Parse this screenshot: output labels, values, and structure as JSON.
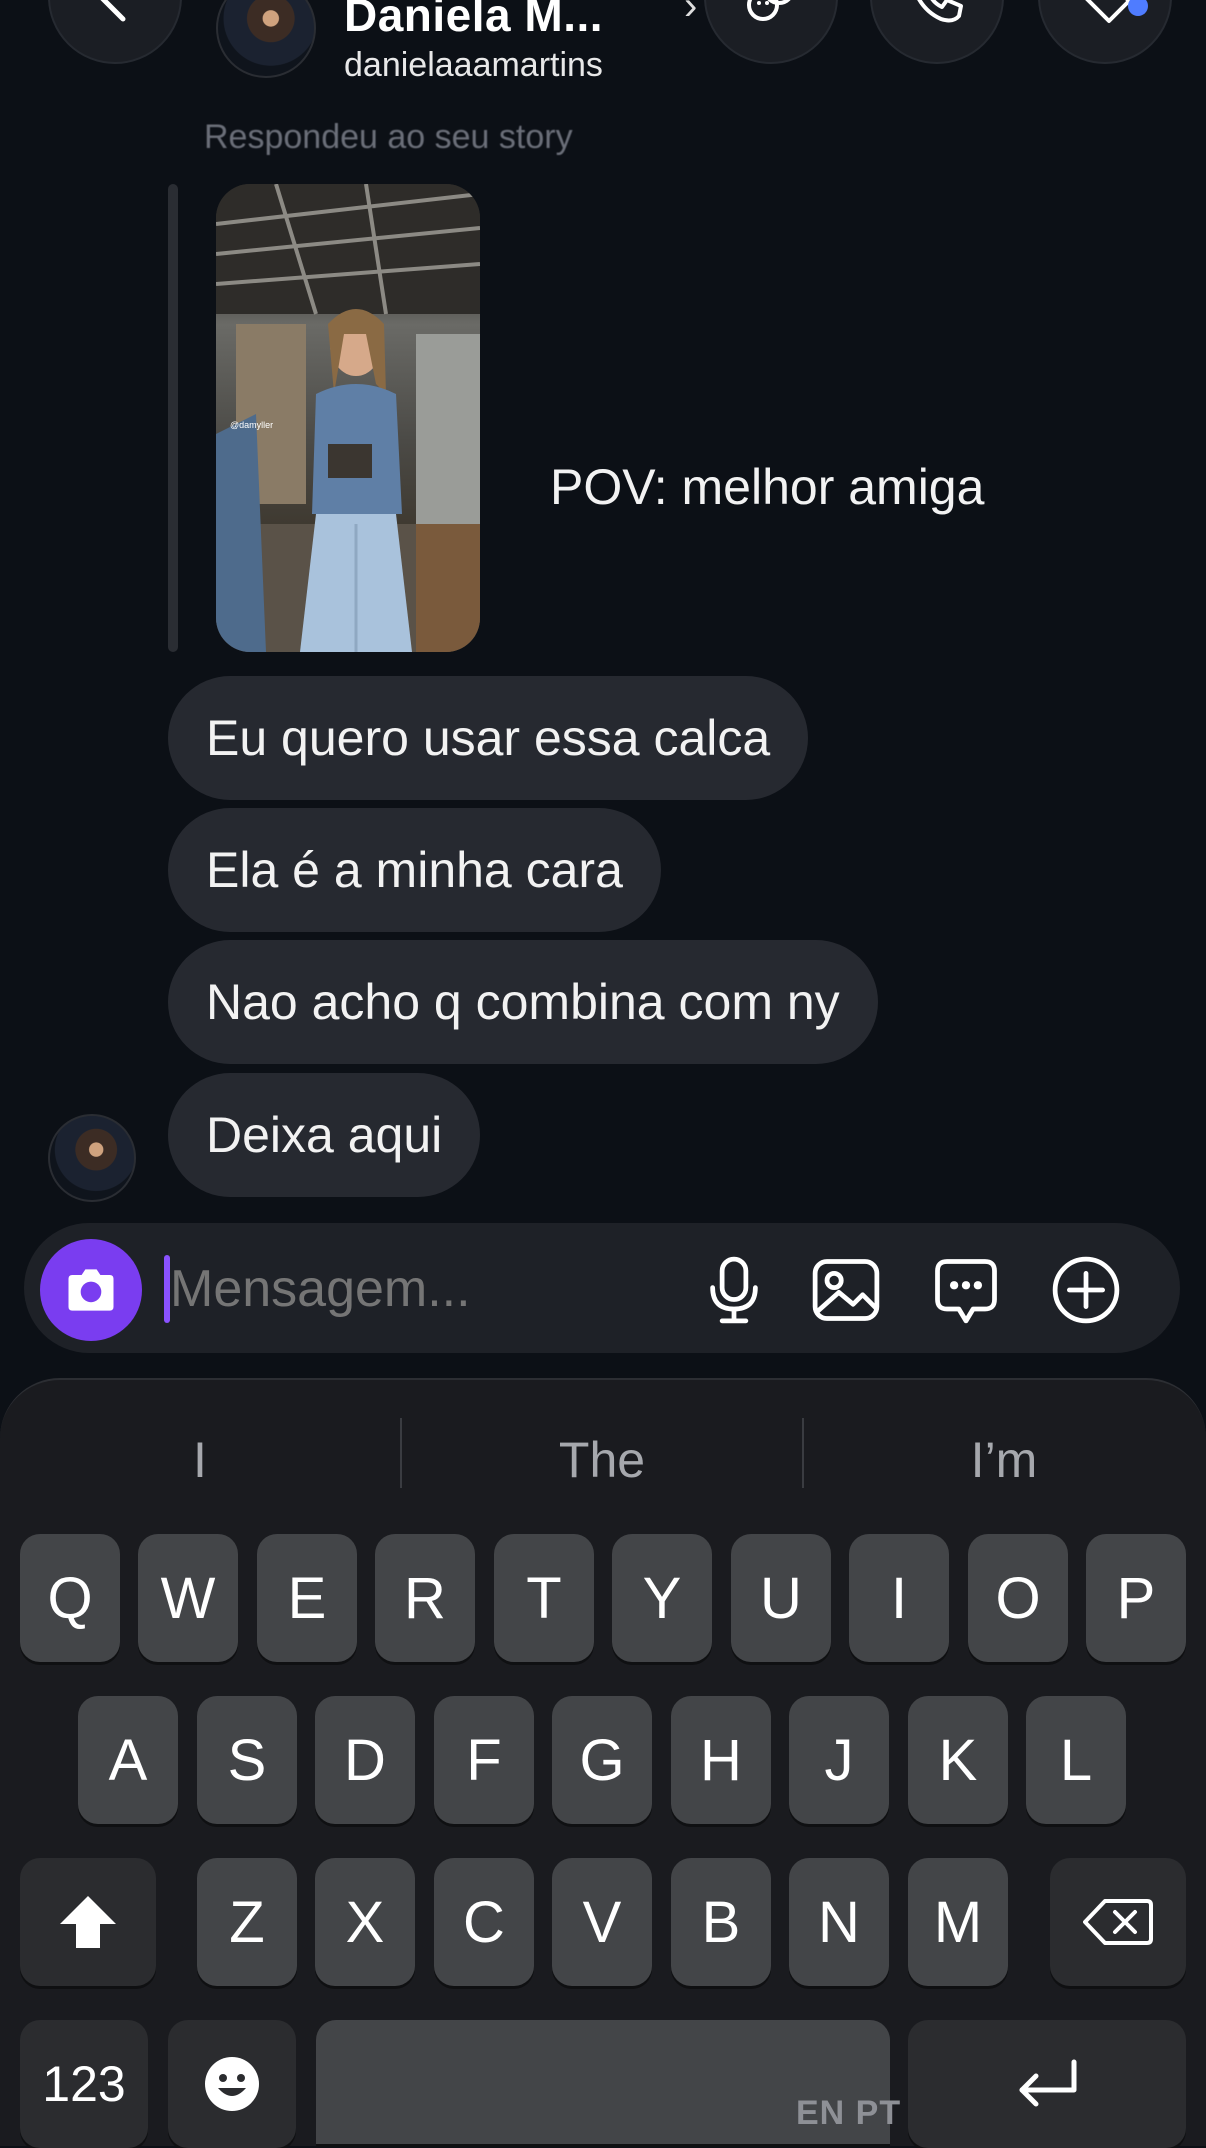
{
  "header": {
    "name": "Daniela M...",
    "username": "danielaaamartins",
    "back_icon": "chevron-left-icon",
    "name_chevron": "›"
  },
  "story_reply": {
    "label": "Respondeu ao seu story",
    "image_watermark": "@damyller",
    "caption": "POV: melhor amiga"
  },
  "messages": [
    "Eu quero usar essa calca",
    "Ela é a minha cara",
    "Nao acho q combina com ny",
    "Deixa aqui"
  ],
  "composer": {
    "placeholder": "Mensagem...",
    "accent": "#7a3df0"
  },
  "keyboard": {
    "suggestions": [
      "I",
      "The",
      "I’m"
    ],
    "row1": [
      "Q",
      "W",
      "E",
      "R",
      "T",
      "Y",
      "U",
      "I",
      "O",
      "P"
    ],
    "row2": [
      "A",
      "S",
      "D",
      "F",
      "G",
      "H",
      "J",
      "K",
      "L"
    ],
    "row3": [
      "Z",
      "X",
      "C",
      "V",
      "B",
      "N",
      "M"
    ],
    "numbers_key": "123",
    "language_label": "EN PT"
  },
  "colors": {
    "background": "#0c1016",
    "bubble": "#262930",
    "notification_dot": "#4f7cff"
  }
}
